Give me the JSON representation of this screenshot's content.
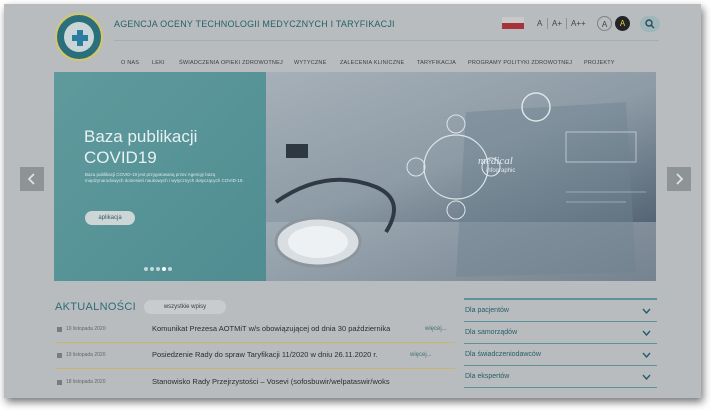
{
  "header": {
    "title": "AGENCJA OCENY TECHNOLOGII MEDYCZNYCH I TARYFIKACJI",
    "font_controls": [
      "A",
      "A+",
      "A++"
    ],
    "contrast_controls": [
      "A",
      "A"
    ]
  },
  "nav": {
    "items": [
      "O NAS",
      "LEKI",
      "ŚWIADCZENIA OPIEKI ZDROWOTNEJ",
      "WYTYCZNE",
      "ZALECENIA KLINICZNE",
      "TARYFIKACJA",
      "PROGRAMY POLITYKI ZDROWOTNEJ",
      "PROJEKTY"
    ]
  },
  "hero": {
    "title_line1": "Baza publikacji",
    "title_line2": "COVID19",
    "description": "Baza publikacji COVID-19 jest przygotowaną przez Agencję bazą międzynarodowych doniesień naukowych i wytycznych dotyczących COVID-19.",
    "button": "aplikacja",
    "image_text_1": "medical",
    "image_text_2": "infographic"
  },
  "news": {
    "heading": "AKTUALNOŚCI",
    "all_button": "wszystkie wpisy",
    "items": [
      {
        "date": "19 listopada 2020",
        "title": "Komunikat Prezesa AOTMiT w/s obowiązującej od dnia 30 października",
        "more": "więcej..."
      },
      {
        "date": "19 listopada 2020",
        "title": "Posiedzenie Rady do spraw Taryfikacji 11/2020 w dniu 26.11.2020 r.",
        "more": "więcej..."
      },
      {
        "date": "18 listopada 2020",
        "title": "Stanowisko Rady Przejrzystości – Vosevi (sofosbuwir/welpataswir/woks",
        "more": ""
      }
    ]
  },
  "sidebar": {
    "items": [
      "Dla pacjentów",
      "Dla samorządów",
      "Dla świadczeniodawców",
      "Dla ekspertów"
    ]
  }
}
